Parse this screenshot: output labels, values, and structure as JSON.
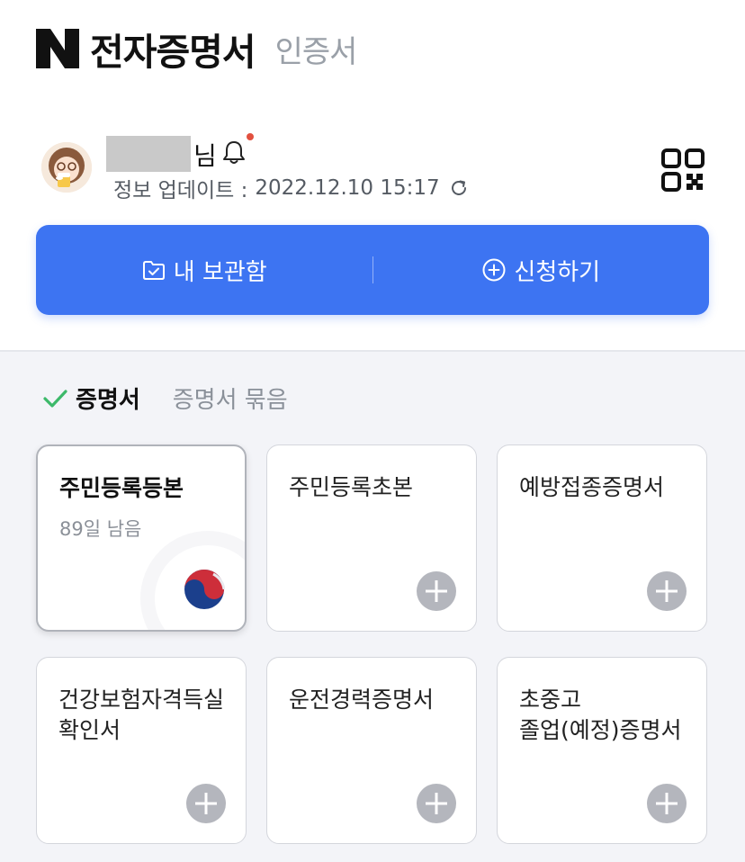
{
  "header": {
    "brand_letter": "N",
    "title": "전자증명서",
    "subtitle": "인증서"
  },
  "profile": {
    "name_suffix": "님",
    "update_label": "정보 업데이트 :",
    "update_time": "2022.12.10 15:17"
  },
  "actions": {
    "storage_label": "내 보관함",
    "apply_label": "신청하기"
  },
  "tabs": {
    "active": "증명서",
    "inactive": "증명서 묶음"
  },
  "cards": [
    {
      "title": "주민등록등본",
      "subtitle": "89일 남음"
    },
    {
      "title": "주민등록초본"
    },
    {
      "title": "예방접종증명서"
    },
    {
      "title": "건강보험자격득실\n확인서"
    },
    {
      "title": "운전경력증명서"
    },
    {
      "title": "초중고\n졸업(예정)증명서"
    }
  ],
  "colors": {
    "primary": "#3d74f2",
    "check": "#3cb96a",
    "notification": "#e2503f"
  }
}
